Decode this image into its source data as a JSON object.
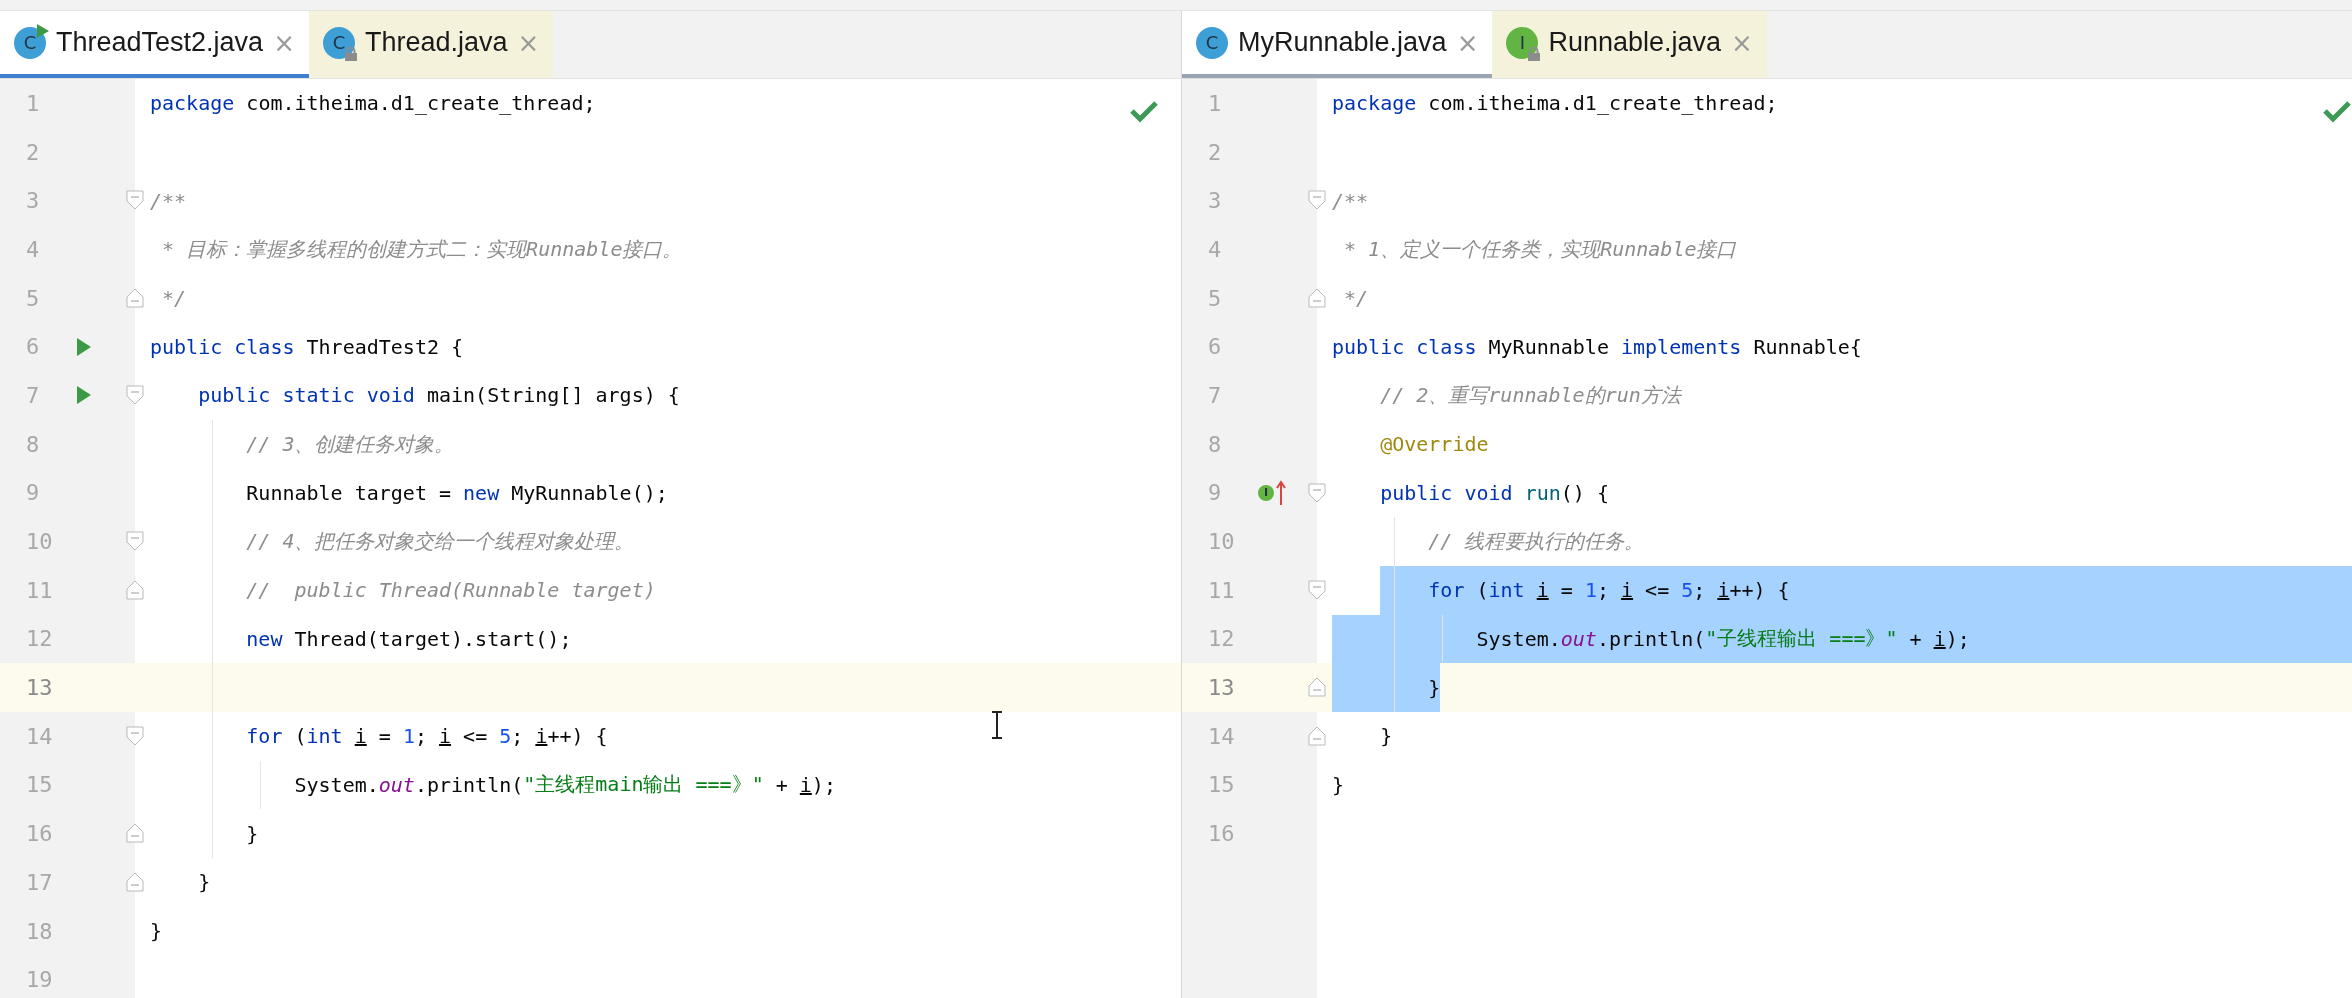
{
  "panes": [
    {
      "focused": true,
      "inspection_ok": true,
      "tabs": [
        {
          "label": "ThreadTest2.java",
          "kind": "main",
          "letter": "C",
          "selected": true,
          "close": "×"
        },
        {
          "label": "Thread.java",
          "kind": "library",
          "letter": "C",
          "selected": false,
          "close": "×"
        }
      ],
      "lines": [
        {
          "number": "1",
          "current": false,
          "tokens": [
            {
              "kind": "keyword",
              "text": "package"
            },
            {
              "kind": "plain",
              "text": " com.itheima.d1_create_thread;"
            }
          ]
        },
        {
          "number": "2",
          "current": false
        },
        {
          "number": "3",
          "kind": "foldstart",
          "current": false,
          "tokens": [
            {
              "kind": "comment",
              "text": "/**"
            }
          ]
        },
        {
          "number": "4",
          "current": false,
          "tokens": [
            {
              "kind": "comment",
              "text": " * 目标：掌握多线程的创建方式二：实现Runnable接口。"
            }
          ]
        },
        {
          "number": "5",
          "kind": "foldend",
          "current": false,
          "tokens": [
            {
              "kind": "comment",
              "text": " */"
            }
          ]
        },
        {
          "number": "6",
          "kind": "run",
          "current": false,
          "tokens": [
            {
              "kind": "keyword",
              "text": "public class"
            },
            {
              "kind": "plain",
              "text": " ThreadTest2 {"
            }
          ],
          "children": [
            {
              "number": "7",
              "kind": "runfoldstart",
              "current": false,
              "tokens": [
                {
                  "kind": "keyword",
                  "text": "public static void"
                },
                {
                  "kind": "plain",
                  "text": " main(String[] args) {"
                }
              ],
              "children": [
                {
                  "number": "8",
                  "current": false,
                  "tokens": [
                    {
                      "kind": "comment",
                      "text": "// 3、创建任务对象。"
                    }
                  ]
                },
                {
                  "number": "9",
                  "current": false,
                  "tokens": [
                    {
                      "kind": "plain",
                      "text": "Runnable target = "
                    },
                    {
                      "kind": "keyword",
                      "text": "new"
                    },
                    {
                      "kind": "plain",
                      "text": " MyRunnable();"
                    }
                  ]
                },
                {
                  "number": "10",
                  "kind": "foldstart",
                  "current": false,
                  "tokens": [
                    {
                      "kind": "comment",
                      "text": "// 4、把任务对象交给一个线程对象处理。"
                    }
                  ]
                },
                {
                  "number": "11",
                  "kind": "foldend",
                  "current": false,
                  "tokens": [
                    {
                      "kind": "comment",
                      "text": "//  public Thread(Runnable target)"
                    }
                  ]
                },
                {
                  "number": "12",
                  "current": false,
                  "tokens": [
                    {
                      "kind": "keyword",
                      "text": "new"
                    },
                    {
                      "kind": "plain",
                      "text": " Thread(target).start();"
                    }
                  ]
                },
                {
                  "number": "13",
                  "current": true
                },
                {
                  "number": "14",
                  "kind": "foldstart",
                  "current": false,
                  "tokens": [
                    {
                      "kind": "keyword",
                      "text": "for"
                    },
                    {
                      "kind": "plain",
                      "text": " ("
                    },
                    {
                      "kind": "keyword",
                      "text": "int "
                    },
                    {
                      "kind": "var",
                      "text": "i"
                    },
                    {
                      "kind": "plain",
                      "text": " = "
                    },
                    {
                      "kind": "number",
                      "text": "1"
                    },
                    {
                      "kind": "plain",
                      "text": "; "
                    },
                    {
                      "kind": "var",
                      "text": "i"
                    },
                    {
                      "kind": "plain",
                      "text": " <= "
                    },
                    {
                      "kind": "number",
                      "text": "5"
                    },
                    {
                      "kind": "plain",
                      "text": "; "
                    },
                    {
                      "kind": "var",
                      "text": "i"
                    },
                    {
                      "kind": "plain",
                      "text": "++) {"
                    }
                  ],
                  "children": [
                    {
                      "number": "15",
                      "current": false,
                      "tokens": [
                        {
                          "kind": "plain",
                          "text": "System."
                        },
                        {
                          "kind": "field",
                          "text": "out"
                        },
                        {
                          "kind": "plain",
                          "text": ".println("
                        },
                        {
                          "kind": "string",
                          "text": "\"主线程main输出 ===》\""
                        },
                        {
                          "kind": "plain",
                          "text": " + "
                        },
                        {
                          "kind": "var",
                          "text": "i"
                        },
                        {
                          "kind": "plain",
                          "text": ");"
                        }
                      ]
                    }
                  ]
                },
                {
                  "number": "16",
                  "kind": "foldend",
                  "current": false,
                  "tokens": [
                    {
                      "kind": "plain",
                      "text": "}"
                    }
                  ]
                }
              ]
            },
            {
              "number": "17",
              "kind": "foldend",
              "current": false,
              "tokens": [
                {
                  "kind": "plain",
                  "text": "}"
                }
              ]
            }
          ]
        },
        {
          "number": "18",
          "current": false,
          "tokens": [
            {
              "kind": "plain",
              "text": "}"
            }
          ]
        },
        {
          "number": "19",
          "current": false
        }
      ]
    },
    {
      "focused": false,
      "inspection_ok": true,
      "tabs": [
        {
          "label": "MyRunnable.java",
          "kind": "class",
          "letter": "C",
          "selected": true,
          "close": "×"
        },
        {
          "label": "Runnable.java",
          "kind": "interface",
          "letter": "I",
          "selected": false,
          "close": "×"
        }
      ],
      "lines": [
        {
          "number": "1",
          "current": false,
          "tokens": [
            {
              "kind": "keyword",
              "text": "package"
            },
            {
              "kind": "plain",
              "text": " com.itheima.d1_create_thread;"
            }
          ]
        },
        {
          "number": "2",
          "current": false
        },
        {
          "number": "3",
          "kind": "foldstart",
          "current": false,
          "tokens": [
            {
              "kind": "comment",
              "text": "/**"
            }
          ]
        },
        {
          "number": "4",
          "current": false,
          "tokens": [
            {
              "kind": "comment",
              "text": " * 1、定义一个任务类，实现Runnable接口"
            }
          ]
        },
        {
          "number": "5",
          "kind": "foldend",
          "current": false,
          "tokens": [
            {
              "kind": "comment",
              "text": " */"
            }
          ]
        },
        {
          "number": "6",
          "current": false,
          "tokens": [
            {
              "kind": "keyword",
              "text": "public class"
            },
            {
              "kind": "plain",
              "text": " MyRunnable "
            },
            {
              "kind": "keyword",
              "text": "implements"
            },
            {
              "kind": "plain",
              "text": " Runnable{"
            }
          ],
          "children": [
            {
              "number": "7",
              "current": false,
              "tokens": [
                {
                  "kind": "comment",
                  "text": "// 2、重写runnable的run方法"
                }
              ]
            },
            {
              "number": "8",
              "current": false,
              "tokens": [
                {
                  "kind": "annotation",
                  "text": "@Override"
                }
              ]
            },
            {
              "number": "9",
              "kind": "implfoldstart",
              "marker_letter": "I",
              "current": false,
              "tokens": [
                {
                  "kind": "keyword",
                  "text": "public void "
                },
                {
                  "kind": "method",
                  "text": "run"
                },
                {
                  "kind": "plain",
                  "text": "() {"
                }
              ],
              "children": [
                {
                  "number": "10",
                  "current": false,
                  "tokens": [
                    {
                      "kind": "comment",
                      "text": "// 线程要执行的任务。"
                    }
                  ]
                },
                {
                  "number": "11",
                  "kind": "foldstart",
                  "current": false,
                  "selected": true,
                  "selected_to_end": true,
                  "tokens": [
                    {
                      "kind": "keyword",
                      "text": "for"
                    },
                    {
                      "kind": "plain",
                      "text": " ("
                    },
                    {
                      "kind": "keyword",
                      "text": "int "
                    },
                    {
                      "kind": "var",
                      "text": "i"
                    },
                    {
                      "kind": "plain",
                      "text": " = "
                    },
                    {
                      "kind": "number",
                      "text": "1"
                    },
                    {
                      "kind": "plain",
                      "text": "; "
                    },
                    {
                      "kind": "var",
                      "text": "i"
                    },
                    {
                      "kind": "plain",
                      "text": " <= "
                    },
                    {
                      "kind": "number",
                      "text": "5"
                    },
                    {
                      "kind": "plain",
                      "text": "; "
                    },
                    {
                      "kind": "var",
                      "text": "i"
                    },
                    {
                      "kind": "plain",
                      "text": "++) {"
                    }
                  ],
                  "children": [
                    {
                      "number": "12",
                      "current": false,
                      "selected": true,
                      "selected_to_end": true,
                      "tokens": [
                        {
                          "kind": "plain",
                          "text": "System."
                        },
                        {
                          "kind": "field",
                          "text": "out"
                        },
                        {
                          "kind": "plain",
                          "text": ".println("
                        },
                        {
                          "kind": "string",
                          "text": "\"子线程输出 ===》\""
                        },
                        {
                          "kind": "plain",
                          "text": " + "
                        },
                        {
                          "kind": "var",
                          "text": "i"
                        },
                        {
                          "kind": "plain",
                          "text": ");"
                        }
                      ]
                    }
                  ]
                },
                {
                  "number": "13",
                  "kind": "foldend",
                  "current": true,
                  "selected": true,
                  "selected_to_end": false,
                  "tokens": [
                    {
                      "kind": "plain",
                      "text": "}"
                    }
                  ]
                }
              ]
            },
            {
              "number": "14",
              "kind": "foldend",
              "current": false,
              "tokens": [
                {
                  "kind": "plain",
                  "text": "}"
                }
              ]
            }
          ]
        },
        {
          "number": "15",
          "current": false,
          "tokens": [
            {
              "kind": "plain",
              "text": "}"
            }
          ]
        },
        {
          "number": "16",
          "current": false
        }
      ]
    }
  ]
}
